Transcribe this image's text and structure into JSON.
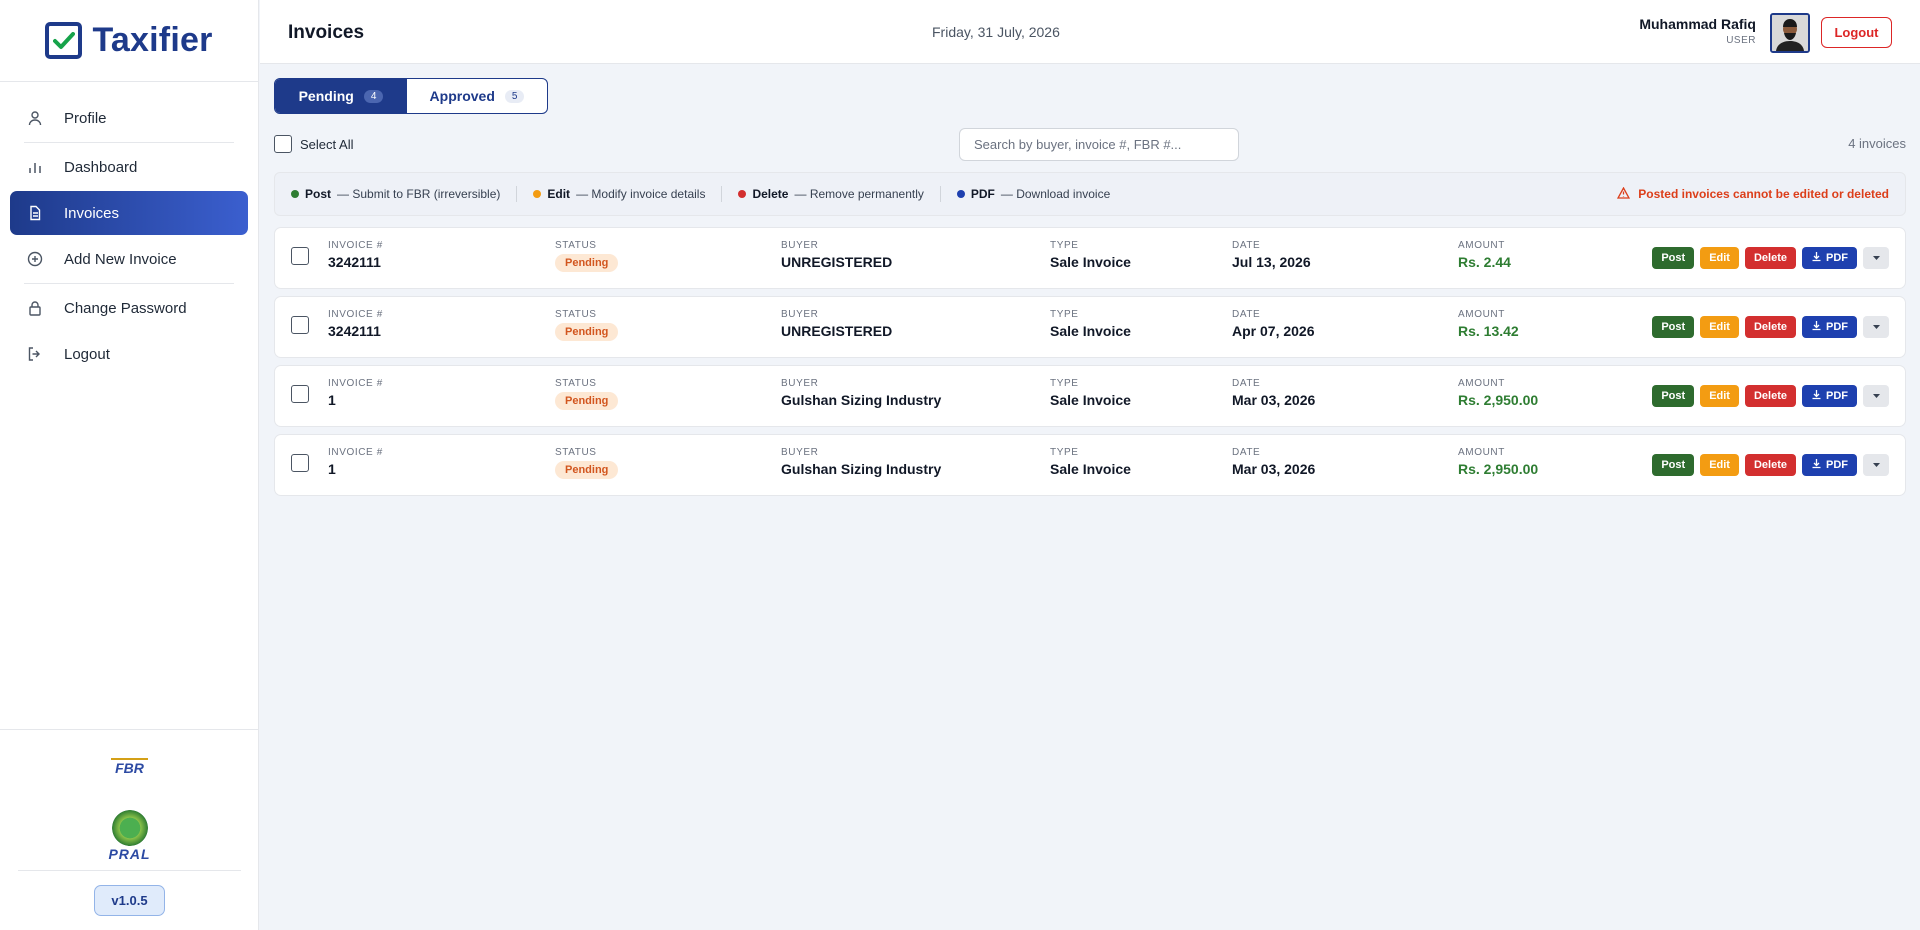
{
  "brand": {
    "name": "Taxifier"
  },
  "sidebar": {
    "items": [
      {
        "label": "Profile",
        "icon": "user-icon"
      },
      {
        "label": "Dashboard",
        "icon": "bar-chart-icon"
      },
      {
        "label": "Invoices",
        "icon": "document-icon",
        "active": true
      },
      {
        "label": "Add New Invoice",
        "icon": "plus-circle-icon"
      },
      {
        "label": "Change Password",
        "icon": "lock-icon"
      },
      {
        "label": "Logout",
        "icon": "logout-icon"
      }
    ],
    "logos": {
      "fbr": "FBR",
      "pral": "PRAL"
    },
    "version": "v1.0.5"
  },
  "header": {
    "title": "Invoices",
    "date": "Friday, 31 July, 2026",
    "user_name": "Muhammad Rafiq",
    "user_role": "USER",
    "logout_label": "Logout"
  },
  "tabs": [
    {
      "label": "Pending",
      "count": "4",
      "active": true
    },
    {
      "label": "Approved",
      "count": "5",
      "active": false
    }
  ],
  "toolbar": {
    "select_all": "Select All",
    "search_placeholder": "Search by buyer, invoice #, FBR #...",
    "count": "4 invoices"
  },
  "legend": {
    "items": [
      {
        "name": "Post",
        "desc": "— Submit to FBR (irreversible)",
        "color": "#2e7d32"
      },
      {
        "name": "Edit",
        "desc": "— Modify invoice details",
        "color": "#f39c12"
      },
      {
        "name": "Delete",
        "desc": "— Remove permanently",
        "color": "#d32f2f"
      },
      {
        "name": "PDF",
        "desc": "— Download invoice",
        "color": "#1e40af"
      }
    ],
    "warning": "Posted invoices cannot be edited or deleted"
  },
  "columns": {
    "invoice": "INVOICE #",
    "status": "STATUS",
    "buyer": "BUYER",
    "type": "TYPE",
    "date": "DATE",
    "amount": "AMOUNT"
  },
  "actions": {
    "post": "Post",
    "edit": "Edit",
    "delete": "Delete",
    "pdf": "PDF"
  },
  "invoices": [
    {
      "invoice": "3242111",
      "status": "Pending",
      "buyer": "UNREGISTERED",
      "type": "Sale Invoice",
      "date": "Jul 13, 2026",
      "amount": "Rs. 2.44"
    },
    {
      "invoice": "3242111",
      "status": "Pending",
      "buyer": "UNREGISTERED",
      "type": "Sale Invoice",
      "date": "Apr 07, 2026",
      "amount": "Rs. 13.42"
    },
    {
      "invoice": "1",
      "status": "Pending",
      "buyer": "Gulshan Sizing Industry",
      "type": "Sale Invoice",
      "date": "Mar 03, 2026",
      "amount": "Rs. 2,950.00"
    },
    {
      "invoice": "1",
      "status": "Pending",
      "buyer": "Gulshan Sizing Industry",
      "type": "Sale Invoice",
      "date": "Mar 03, 2026",
      "amount": "Rs. 2,950.00"
    }
  ]
}
